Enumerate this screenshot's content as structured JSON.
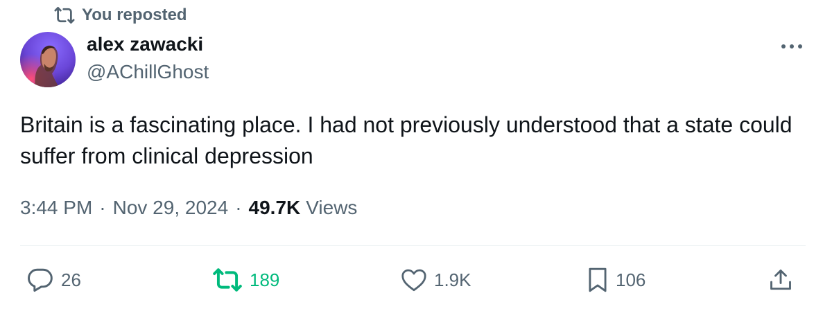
{
  "repost_banner": {
    "text": "You reposted",
    "icon": "repost-icon"
  },
  "author": {
    "display_name": "alex zawacki",
    "handle": "@AChillGhost",
    "avatar": "avatar-photo"
  },
  "more_icon": "more-icon",
  "tweet": {
    "text": "Britain is a fascinating place. I had not previously understood that a state could suffer from clinical depression"
  },
  "meta": {
    "time": "3:44 PM",
    "separator": "·",
    "date": "Nov 29, 2024",
    "views_count": "49.7K",
    "views_label": "Views"
  },
  "actions": {
    "reply": {
      "icon": "reply-icon",
      "count": "26"
    },
    "repost": {
      "icon": "repost-icon",
      "count": "189",
      "color": "#00ba7c"
    },
    "like": {
      "icon": "heart-icon",
      "count": "1.9K"
    },
    "bookmark": {
      "icon": "bookmark-icon",
      "count": "106"
    },
    "share": {
      "icon": "share-icon"
    }
  },
  "colors": {
    "text_primary": "#0f1419",
    "text_secondary": "#536471",
    "repost_active": "#00ba7c",
    "divider": "#eff3f4"
  }
}
